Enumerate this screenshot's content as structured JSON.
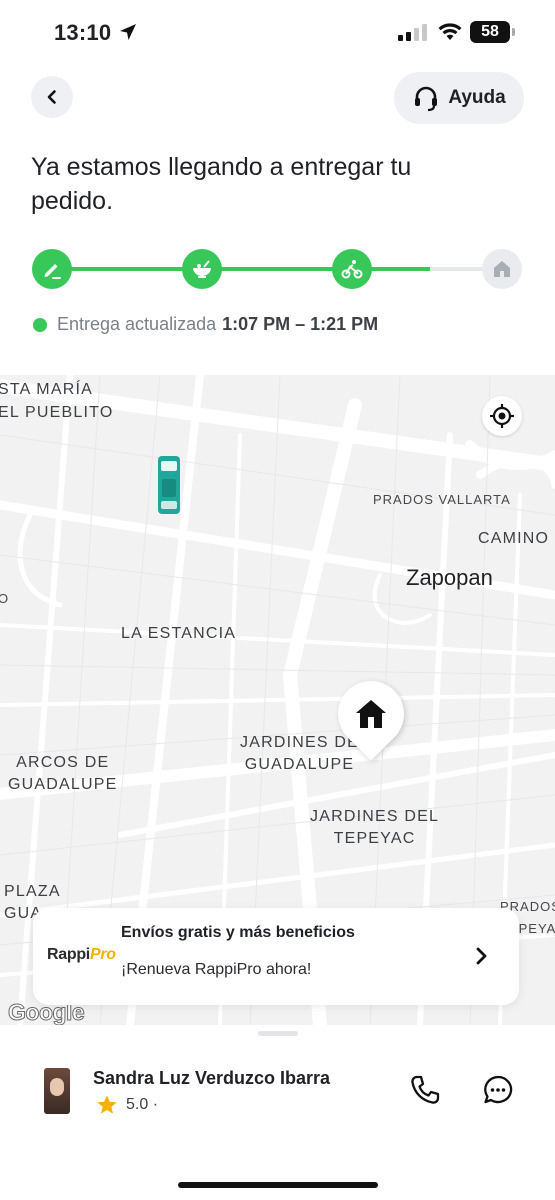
{
  "status_bar": {
    "time": "13:10",
    "battery": "58"
  },
  "header": {
    "help_label": "Ayuda"
  },
  "title": "Ya estamos llegando a entregar tu pedido.",
  "progress": {
    "fraction": 0.84,
    "steps": [
      {
        "icon": "pencil-icon",
        "state": "done"
      },
      {
        "icon": "bowl-icon",
        "state": "done"
      },
      {
        "icon": "courier-bike-icon",
        "state": "done"
      },
      {
        "icon": "house-icon",
        "state": "pending"
      }
    ]
  },
  "eta": {
    "label": "Entrega actualizada",
    "value": "1:07 PM – 1:21 PM"
  },
  "map": {
    "labels": {
      "santa_maria_1": "STA MARÍA",
      "santa_maria_2": "EL PUEBLITO",
      "prados_vallarta": "PRADOS VALLARTA",
      "camino": "CAMINO",
      "zapopan": "Zapopan",
      "la_estancia": "LA ESTANCIA",
      "arcos": "ARCOS DE\nGUADALUPE",
      "jardines_guadalupe": "JARDINES DE\nGUADALUPE",
      "jardines_tepeyac": "JARDINES DEL\nTEPEYAC",
      "plaza": "PLAZA\nGUA",
      "prados_right": "PRADOS\nTEPEYAC",
      "edge_o": "O"
    },
    "attribution": "Google"
  },
  "promo": {
    "brand": "Rappi",
    "brand_suffix": "Pro",
    "headline": "Envíos gratis y más beneficios",
    "subline": "¡Renueva RappiPro ahora!"
  },
  "courier": {
    "name": "Sandra Luz Verduzco Ibarra",
    "rating": "5.0 ·"
  },
  "colors": {
    "accent": "#38c85a",
    "pending": "#e9ebef",
    "map_bg": "#f2f2f3"
  }
}
